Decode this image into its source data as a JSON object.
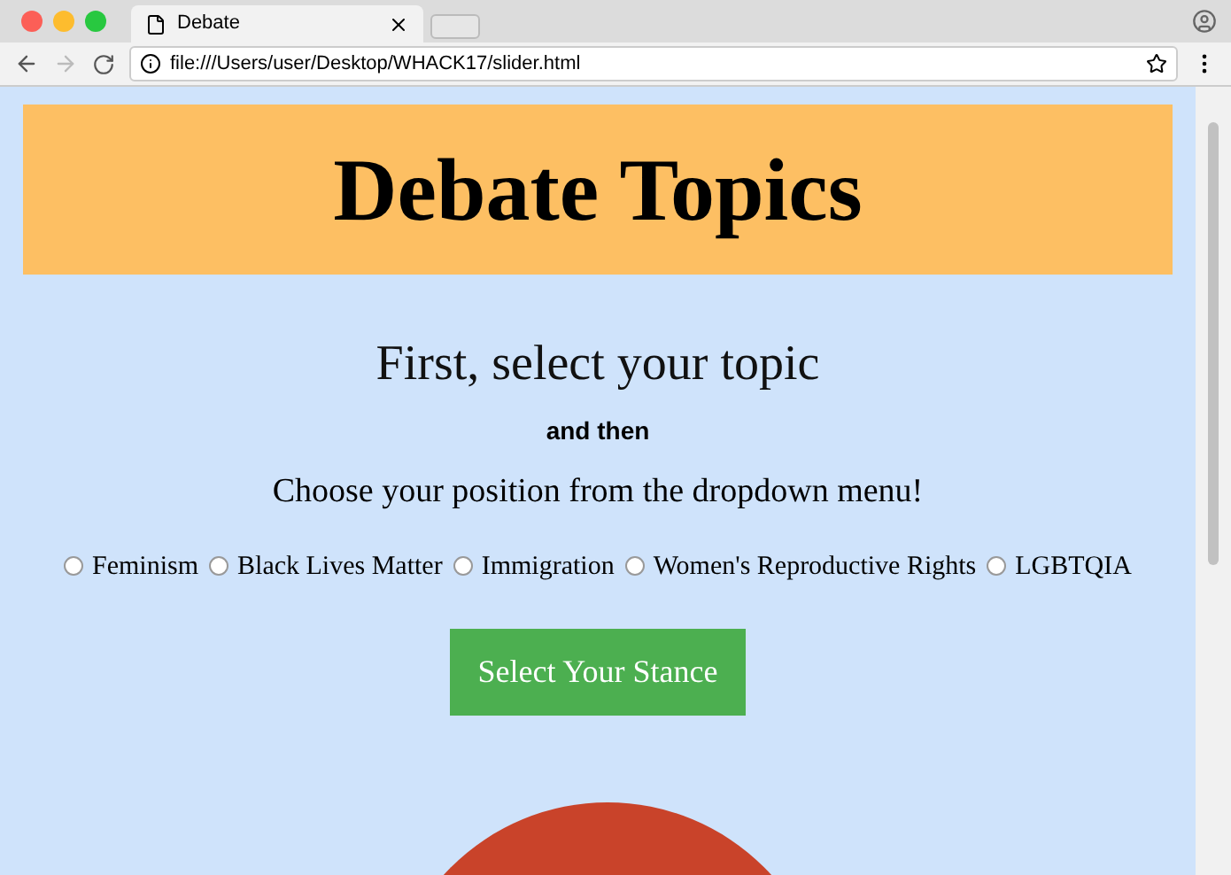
{
  "browser": {
    "tab_title": "Debate",
    "url": "file:///Users/user/Desktop/WHACK17/slider.html"
  },
  "banner": {
    "title": "Debate Topics"
  },
  "heading": "First, select your topic",
  "subheading": "and then",
  "instruction": "Choose your position from the dropdown menu!",
  "topics": [
    {
      "label": "Feminism",
      "selected": false
    },
    {
      "label": "Black Lives Matter",
      "selected": false
    },
    {
      "label": "Immigration",
      "selected": false
    },
    {
      "label": "Women's Reproductive Rights",
      "selected": false
    },
    {
      "label": "LGBTQIA",
      "selected": false
    }
  ],
  "button": "Select Your Stance"
}
